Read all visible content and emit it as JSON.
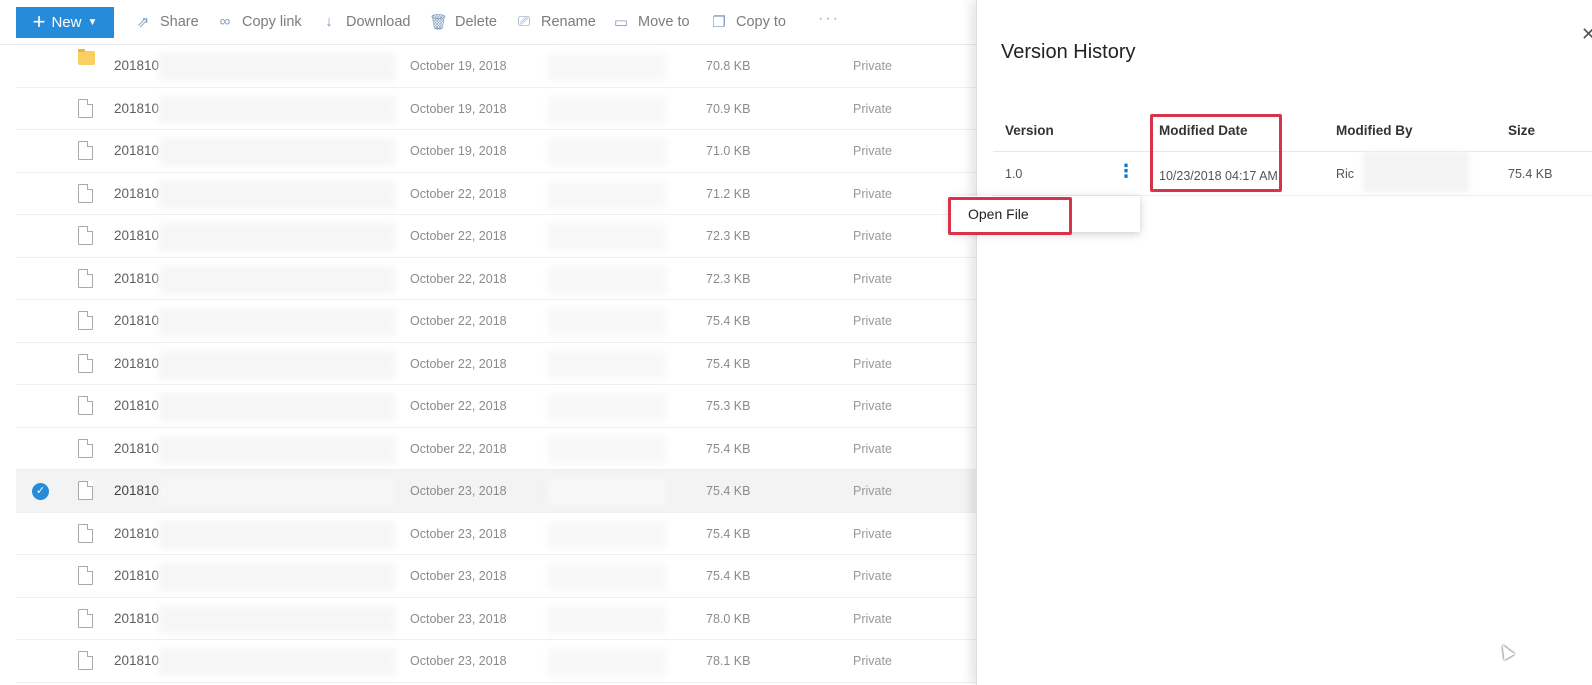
{
  "toolbar": {
    "new_label": "New",
    "share_label": "Share",
    "copy_link_label": "Copy link",
    "download_label": "Download",
    "delete_label": "Delete",
    "rename_label": "Rename",
    "move_to_label": "Move to",
    "copy_to_label": "Copy to",
    "more_label": "···"
  },
  "files": [
    {
      "name": "201810",
      "date": "October 19, 2018",
      "size": "70.8 KB",
      "sharing": "Private",
      "type": "folder"
    },
    {
      "name": "201810",
      "date": "October 19, 2018",
      "size": "70.9 KB",
      "sharing": "Private",
      "type": "file"
    },
    {
      "name": "201810",
      "date": "October 19, 2018",
      "size": "71.0 KB",
      "sharing": "Private",
      "type": "file"
    },
    {
      "name": "201810",
      "date": "October 22, 2018",
      "size": "71.2 KB",
      "sharing": "Private",
      "type": "file"
    },
    {
      "name": "201810",
      "date": "October 22, 2018",
      "size": "72.3 KB",
      "sharing": "Private",
      "type": "file"
    },
    {
      "name": "201810",
      "date": "October 22, 2018",
      "size": "72.3 KB",
      "sharing": "Private",
      "type": "file"
    },
    {
      "name": "201810",
      "date": "October 22, 2018",
      "size": "75.4 KB",
      "sharing": "Private",
      "type": "file"
    },
    {
      "name": "201810",
      "date": "October 22, 2018",
      "size": "75.4 KB",
      "sharing": "Private",
      "type": "file"
    },
    {
      "name": "201810",
      "date": "October 22, 2018",
      "size": "75.3 KB",
      "sharing": "Private",
      "type": "file"
    },
    {
      "name": "201810",
      "date": "October 22, 2018",
      "size": "75.4 KB",
      "sharing": "Private",
      "type": "file"
    },
    {
      "name": "201810",
      "date": "October 23, 2018",
      "size": "75.4 KB",
      "sharing": "Private",
      "type": "file",
      "selected": true
    },
    {
      "name": "201810",
      "date": "October 23, 2018",
      "size": "75.4 KB",
      "sharing": "Private",
      "type": "file"
    },
    {
      "name": "201810",
      "date": "October 23, 2018",
      "size": "75.4 KB",
      "sharing": "Private",
      "type": "file"
    },
    {
      "name": "201810",
      "date": "October 23, 2018",
      "size": "78.0 KB",
      "sharing": "Private",
      "type": "file"
    },
    {
      "name": "201810",
      "date": "October 23, 2018",
      "size": "78.1 KB",
      "sharing": "Private",
      "type": "file"
    }
  ],
  "version_history": {
    "title": "Version History",
    "columns": {
      "version": "Version",
      "modified_date": "Modified Date",
      "modified_by": "Modified By",
      "size": "Size"
    },
    "rows": [
      {
        "version": "1.0",
        "modified_date": "10/23/2018 04:17 AM",
        "modified_by": "Ric",
        "size": "75.4 KB"
      }
    ]
  },
  "context_menu": {
    "open_file": "Open File"
  },
  "colors": {
    "accent": "#0078d4",
    "highlight": "#d7334a"
  }
}
